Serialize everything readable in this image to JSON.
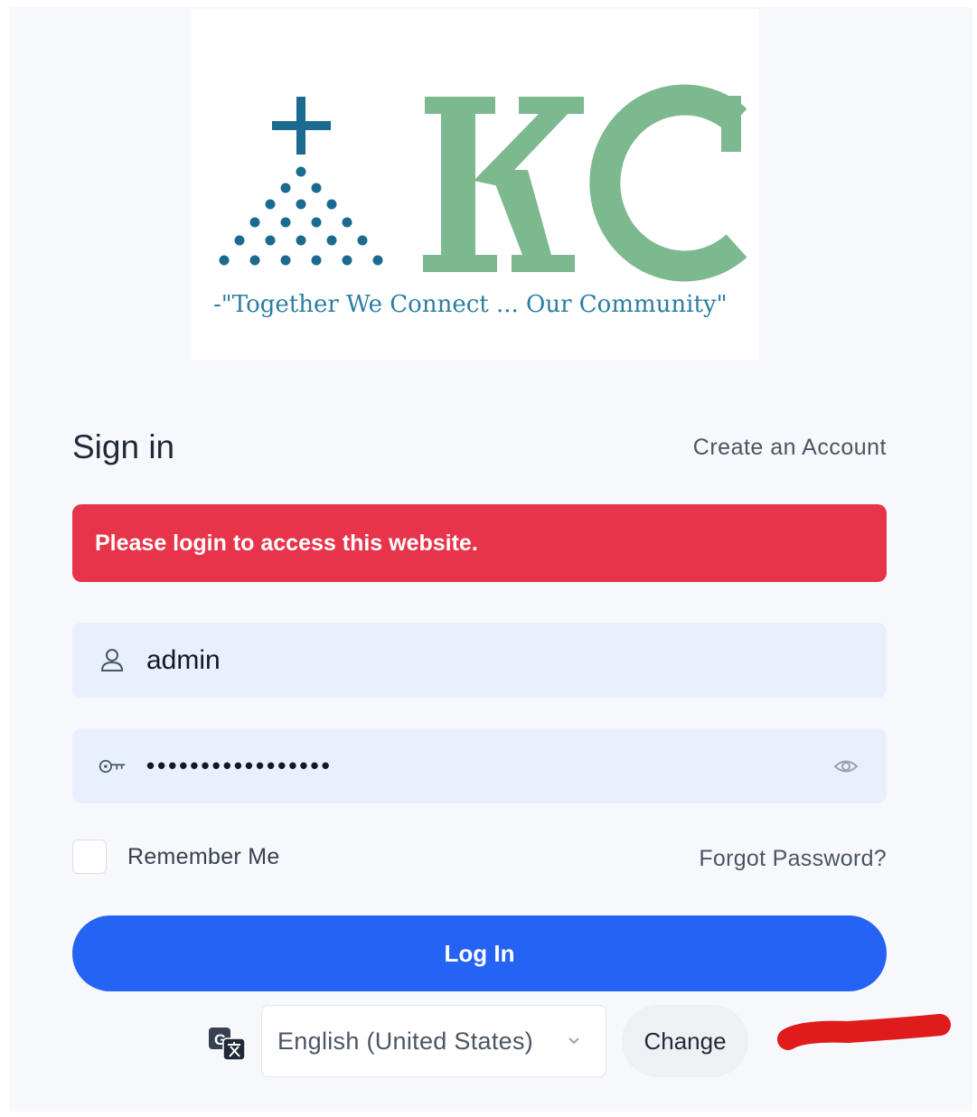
{
  "logo": {
    "tagline": "-\"Together We Connect ... Our Community\"",
    "brand_blue": "#1b6a8f",
    "brand_green": "#7cb98f"
  },
  "form": {
    "title": "Sign in",
    "create_account": "Create an Account",
    "alert": "Please login to access this website.",
    "alert_color": "#e8344a",
    "username": {
      "value": "admin",
      "icon": "user-icon"
    },
    "password": {
      "value": "•••••••••••••••••",
      "icon": "key-icon",
      "toggle_icon": "eye-icon"
    },
    "remember_me": {
      "label": "Remember Me",
      "checked": false
    },
    "forgot_password": "Forgot Password?",
    "login_button": "Log In",
    "accent": "#2563f5"
  },
  "language": {
    "icon": "translate-icon",
    "selected": "English (United States)",
    "change_button": "Change"
  }
}
